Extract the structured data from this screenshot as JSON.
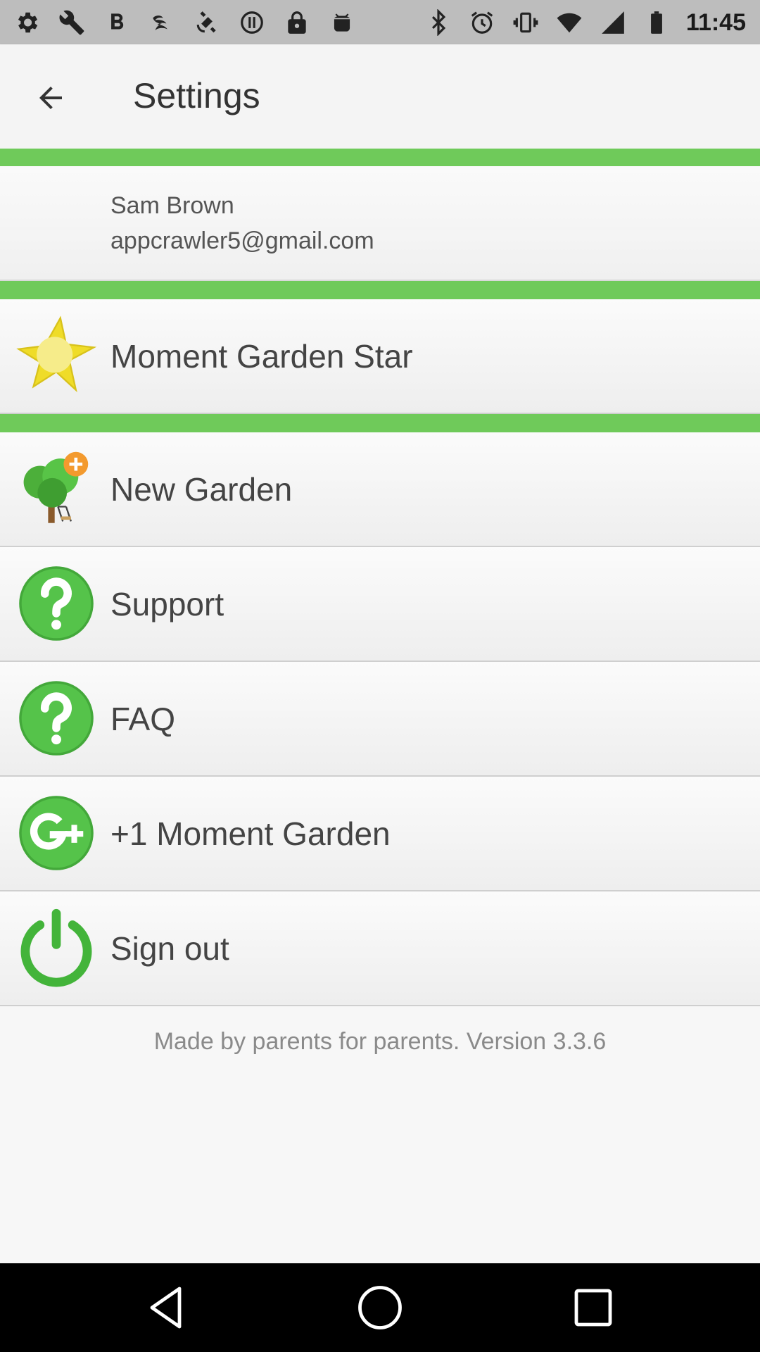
{
  "status_bar": {
    "time": "11:45",
    "left_icons": [
      "settings-icon",
      "wrench-icon",
      "bold-icon",
      "flash-icon",
      "satellite-icon",
      "record-icon",
      "lock-icon",
      "android-icon"
    ],
    "right_icons": [
      "bluetooth-icon",
      "alarm-icon",
      "vibrate-icon",
      "wifi-icon",
      "cellular-icon",
      "battery-icon"
    ]
  },
  "app_bar": {
    "title": "Settings",
    "back_icon": "back-arrow-icon"
  },
  "account": {
    "name": "Sam Brown",
    "email": "appcrawler5@gmail.com"
  },
  "menu": [
    {
      "label": "Moment Garden Star",
      "icon": "star-icon"
    },
    {
      "label": "New Garden",
      "icon": "tree-add-icon"
    },
    {
      "label": "Support",
      "icon": "help-icon"
    },
    {
      "label": "FAQ",
      "icon": "help-icon"
    },
    {
      "label": "+1 Moment Garden",
      "icon": "google-plus-icon"
    },
    {
      "label": "Sign out",
      "icon": "power-icon"
    }
  ],
  "footer": {
    "text": "Made by parents for parents. Version 3.3.6"
  },
  "colors": {
    "accent_green": "#6fca5a",
    "icon_green": "#55c34a",
    "star_yellow": "#f2df2a"
  }
}
